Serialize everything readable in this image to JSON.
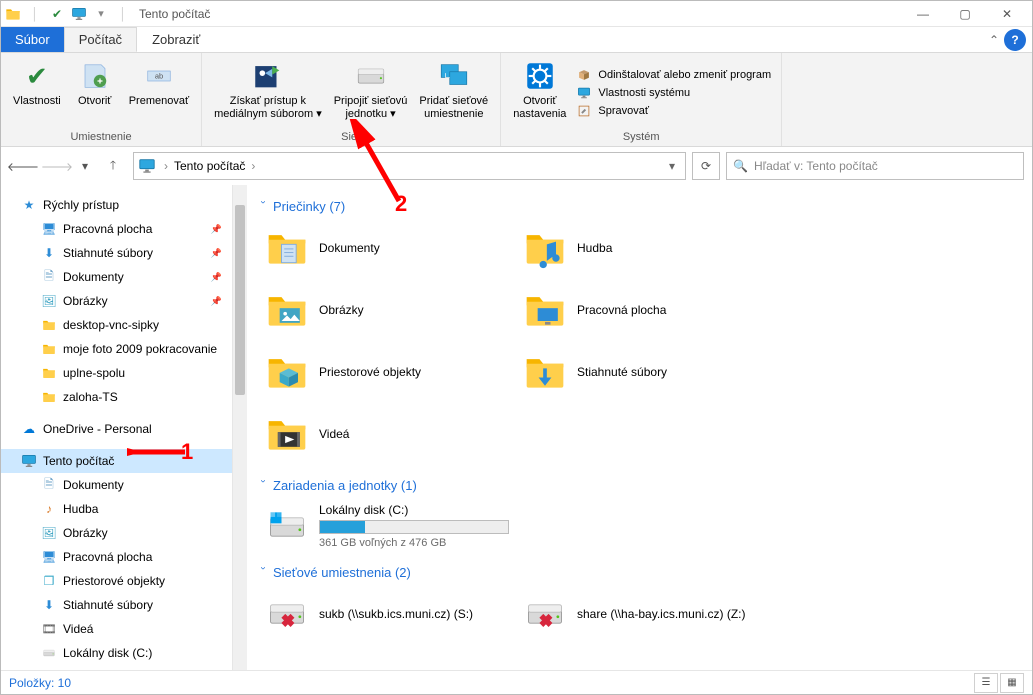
{
  "title": "Tento počítač",
  "tabs": {
    "file": "Súbor",
    "computer": "Počítač",
    "view": "Zobraziť"
  },
  "ribbon": {
    "location": {
      "properties": "Vlastnosti",
      "open": "Otvoriť",
      "rename": "Premenovať",
      "group": "Umiestnenie"
    },
    "network": {
      "media": "Získať prístup k\nmediálnym súborom ▾",
      "map": "Pripojiť sieťovú\njednotku ▾",
      "addloc": "Pridať sieťové\numiestnenie",
      "group": "Sieť"
    },
    "system": {
      "settings": "Otvoriť\nnastavenia",
      "uninstall": "Odinštalovať alebo zmeniť program",
      "props": "Vlastnosti systému",
      "manage": "Spravovať",
      "group": "Systém"
    }
  },
  "breadcrumb": {
    "item0": "Tento počítač"
  },
  "search": {
    "placeholder": "Hľadať v: Tento počítač"
  },
  "nav": {
    "quick": "Rýchly prístup",
    "quick_items": {
      "desktop": "Pracovná plocha",
      "downloads": "Stiahnuté súbory",
      "documents": "Dokumenty",
      "pictures": "Obrázky",
      "f1": "desktop-vnc-sipky",
      "f2": "moje foto 2009 pokracovanie",
      "f3": "uplne-spolu",
      "f4": "zaloha-TS"
    },
    "onedrive": "OneDrive - Personal",
    "thispc": "Tento počítač",
    "thispc_items": {
      "documents": "Dokumenty",
      "music": "Hudba",
      "pictures": "Obrázky",
      "desktop": "Pracovná plocha",
      "objects3d": "Priestorové objekty",
      "downloads": "Stiahnuté súbory",
      "videos": "Videá",
      "driveC": "Lokálny disk (C:)"
    }
  },
  "content": {
    "folders_header": "Priečinky (7)",
    "folders": {
      "documents": "Dokumenty",
      "music": "Hudba",
      "pictures": "Obrázky",
      "desktop": "Pracovná plocha",
      "objects3d": "Priestorové objekty",
      "downloads": "Stiahnuté súbory",
      "videos": "Videá"
    },
    "devices_header": "Zariadenia a jednotky (1)",
    "drive": {
      "label": "Lokálny disk (C:)",
      "free": "361 GB voľných z 476 GB",
      "fill_pct": 24
    },
    "netloc_header": "Sieťové umiestnenia (2)",
    "net": {
      "n1": "sukb (\\\\sukb.ics.muni.cz) (S:)",
      "n2": "share (\\\\ha-bay.ics.muni.cz) (Z:)"
    }
  },
  "status": {
    "items": "Položky: 10"
  },
  "annotations": {
    "one": "1",
    "two": "2"
  }
}
